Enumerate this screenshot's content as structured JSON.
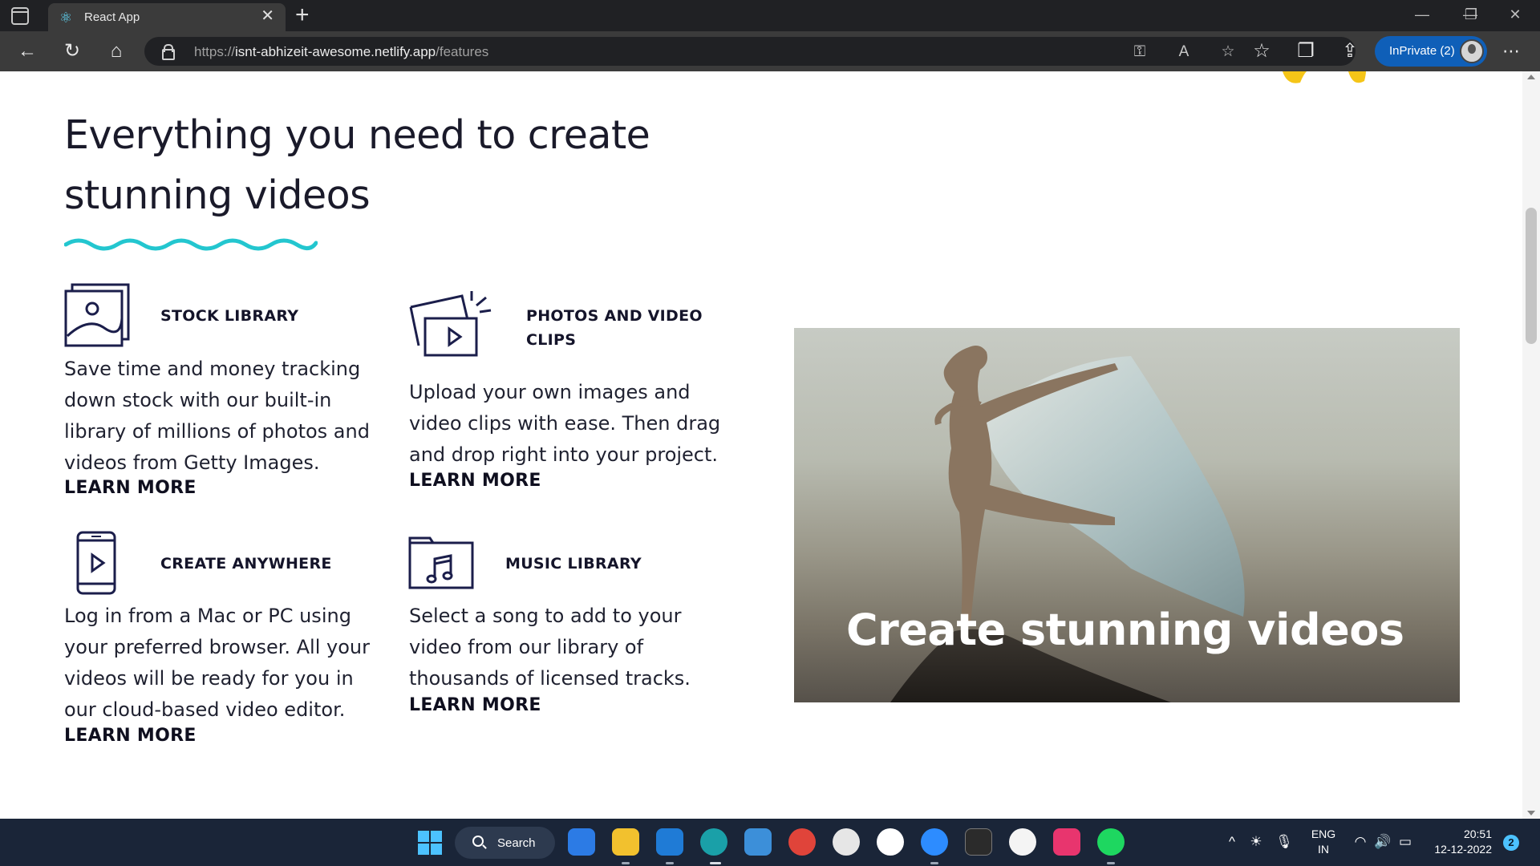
{
  "browser": {
    "tab_title": "React App",
    "url_scheme": "https://",
    "url_host": "isnt-abhizeit-awesome.netlify.app",
    "url_path": "/features",
    "inprivate_label": "InPrivate (2)"
  },
  "page": {
    "heading": "Everything you need to create stunning videos",
    "accent_color": "#23c6cf",
    "features": [
      {
        "title": "STOCK LIBRARY",
        "icon": "image-icon",
        "description": "Save time and money tracking down stock with our built-in library of millions of photos and videos from Getty Images.",
        "link": "LEARN MORE"
      },
      {
        "title": "PHOTOS AND VIDEO CLIPS",
        "icon": "video-clip-icon",
        "description": "Upload your own images and video clips with ease. Then drag and drop right into your project.",
        "link": "LEARN MORE"
      },
      {
        "title": "CREATE ANYWHERE",
        "icon": "phone-play-icon",
        "description": "Log in from a Mac or PC using your preferred browser. All your videos will be ready for you in our cloud-based video editor.",
        "link": "LEARN MORE"
      },
      {
        "title": "MUSIC LIBRARY",
        "icon": "music-folder-icon",
        "description": "Select a song to add to your video from our library of thousands of licensed tracks.",
        "link": "LEARN MORE"
      }
    ],
    "hero_caption": "Create stunning videos"
  },
  "taskbar": {
    "search_label": "Search",
    "language": "ENG",
    "region": "IN",
    "time": "20:51",
    "date": "12-12-2022",
    "notification_count": "2"
  }
}
